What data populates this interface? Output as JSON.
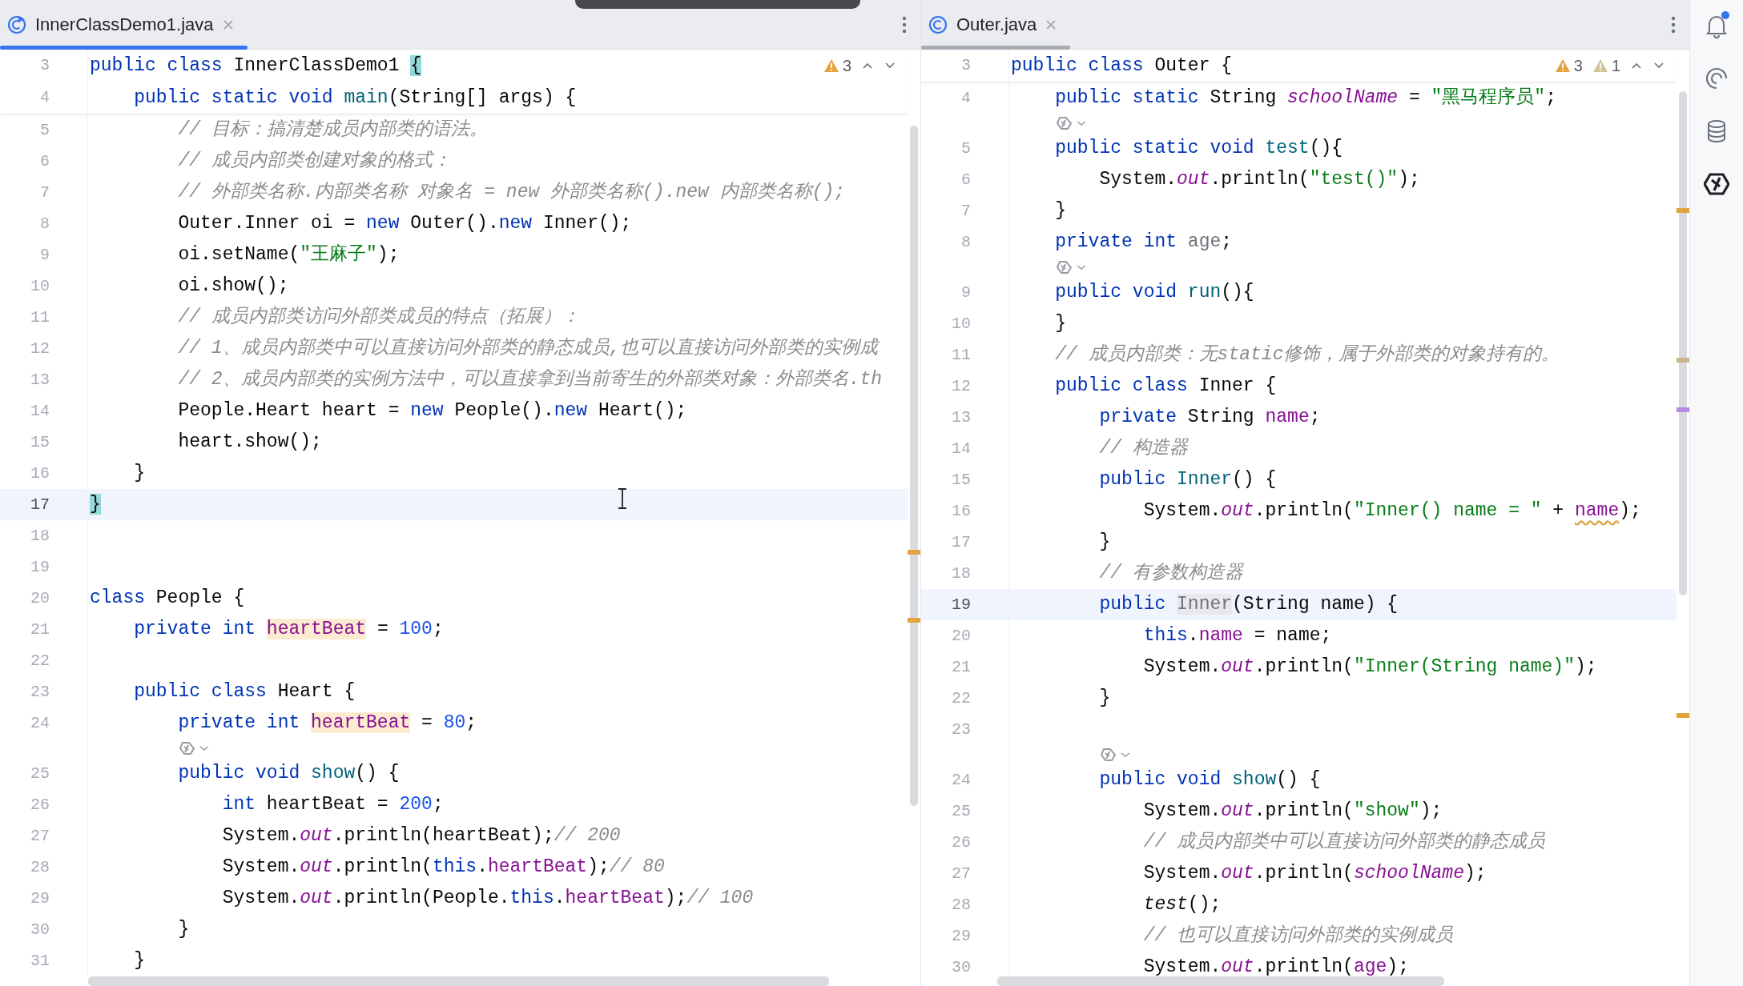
{
  "editors": [
    {
      "focused": true,
      "tabs": [
        {
          "label": "InnerClassDemo1.java",
          "selected": true,
          "kind": "runnable-class"
        }
      ],
      "inspection": {
        "warnings": "3"
      },
      "sticky_lines": [
        {
          "number": "3",
          "current": false,
          "tokens": [
            {
              "kind": "keyword",
              "text": "public class"
            },
            {
              "kind": "plain",
              "text": " InnerClassDemo1 "
            },
            {
              "kind": "plain",
              "text": "{",
              "highlighted": true
            }
          ]
        },
        {
          "number": "4",
          "current": false,
          "tokens": [
            {
              "kind": "keyword",
              "text": "    public static void "
            },
            {
              "kind": "method",
              "text": "main"
            },
            {
              "kind": "plain",
              "text": "(String[] args) {"
            }
          ]
        }
      ],
      "lines": [
        {
          "kind": "code",
          "number": "5",
          "current": false,
          "tokens": [
            {
              "kind": "comment",
              "text": "        // 目标：搞清楚成员内部类的语法。"
            }
          ]
        },
        {
          "kind": "code",
          "number": "6",
          "current": false,
          "tokens": [
            {
              "kind": "comment",
              "text": "        // 成员内部类创建对象的格式："
            }
          ]
        },
        {
          "kind": "code",
          "number": "7",
          "current": false,
          "tokens": [
            {
              "kind": "comment",
              "text": "        // 外部类名称.内部类名称 对象名 = new 外部类名称().new 内部类名称();"
            }
          ]
        },
        {
          "kind": "code",
          "number": "8",
          "current": false,
          "tokens": [
            {
              "kind": "plain",
              "text": "        Outer.Inner oi = "
            },
            {
              "kind": "keyword",
              "text": "new"
            },
            {
              "kind": "plain",
              "text": " Outer()."
            },
            {
              "kind": "keyword",
              "text": "new"
            },
            {
              "kind": "plain",
              "text": " Inner();"
            }
          ]
        },
        {
          "kind": "code",
          "number": "9",
          "current": false,
          "tokens": [
            {
              "kind": "plain",
              "text": "        oi.setName("
            },
            {
              "kind": "string",
              "text": "\"王麻子\""
            },
            {
              "kind": "plain",
              "text": ");"
            }
          ]
        },
        {
          "kind": "code",
          "number": "10",
          "current": false,
          "tokens": [
            {
              "kind": "plain",
              "text": "        oi.show();"
            }
          ]
        },
        {
          "kind": "code",
          "number": "11",
          "current": false,
          "tokens": [
            {
              "kind": "comment",
              "text": "        // 成员内部类访问外部类成员的特点（拓展）："
            }
          ]
        },
        {
          "kind": "code",
          "number": "12",
          "current": false,
          "tokens": [
            {
              "kind": "comment",
              "text": "        // 1、成员内部类中可以直接访问外部类的静态成员,也可以直接访问外部类的实例成"
            }
          ]
        },
        {
          "kind": "code",
          "number": "13",
          "current": false,
          "tokens": [
            {
              "kind": "comment",
              "text": "        // 2、成员内部类的实例方法中，可以直接拿到当前寄生的外部类对象：外部类名.th"
            }
          ]
        },
        {
          "kind": "code",
          "number": "14",
          "current": false,
          "tokens": [
            {
              "kind": "plain",
              "text": "        People.Heart heart = "
            },
            {
              "kind": "keyword",
              "text": "new"
            },
            {
              "kind": "plain",
              "text": " People()."
            },
            {
              "kind": "keyword",
              "text": "new"
            },
            {
              "kind": "plain",
              "text": " Heart();"
            }
          ]
        },
        {
          "kind": "code",
          "number": "15",
          "current": false,
          "tokens": [
            {
              "kind": "plain",
              "text": "        heart.show();"
            }
          ]
        },
        {
          "kind": "code",
          "number": "16",
          "current": false,
          "tokens": [
            {
              "kind": "plain",
              "text": "    }"
            }
          ]
        },
        {
          "kind": "code",
          "number": "17",
          "current": true,
          "tokens": [
            {
              "kind": "plain",
              "text": "}",
              "highlighted": true
            }
          ]
        },
        {
          "kind": "code",
          "number": "18",
          "current": false
        },
        {
          "kind": "code",
          "number": "19",
          "current": false
        },
        {
          "kind": "code",
          "number": "20",
          "current": false,
          "tokens": [
            {
              "kind": "keyword",
              "text": "class"
            },
            {
              "kind": "plain",
              "text": " People {"
            }
          ]
        },
        {
          "kind": "code",
          "number": "21",
          "current": false,
          "tokens": [
            {
              "kind": "keyword",
              "text": "    private int "
            },
            {
              "kind": "field",
              "text": "heartBeat",
              "highlighted": true
            },
            {
              "kind": "plain",
              "text": " = "
            },
            {
              "kind": "number",
              "text": "100"
            },
            {
              "kind": "plain",
              "text": ";"
            }
          ]
        },
        {
          "kind": "code",
          "number": "22",
          "current": false
        },
        {
          "kind": "code",
          "number": "23",
          "current": false,
          "tokens": [
            {
              "kind": "keyword",
              "text": "    public class"
            },
            {
              "kind": "plain",
              "text": " Heart {"
            }
          ]
        },
        {
          "kind": "code",
          "number": "24",
          "current": false,
          "tokens": [
            {
              "kind": "keyword",
              "text": "        private int "
            },
            {
              "kind": "field",
              "text": "heartBeat",
              "highlighted": true
            },
            {
              "kind": "plain",
              "text": " = "
            },
            {
              "kind": "number",
              "text": "80"
            },
            {
              "kind": "plain",
              "text": ";"
            }
          ]
        },
        {
          "kind": "hint"
        },
        {
          "kind": "code",
          "number": "25",
          "current": false,
          "tokens": [
            {
              "kind": "keyword",
              "text": "        public void "
            },
            {
              "kind": "method",
              "text": "show"
            },
            {
              "kind": "plain",
              "text": "() {"
            }
          ]
        },
        {
          "kind": "code",
          "number": "26",
          "current": false,
          "tokens": [
            {
              "kind": "keyword",
              "text": "            int"
            },
            {
              "kind": "plain",
              "text": " heartBeat = "
            },
            {
              "kind": "number",
              "text": "200"
            },
            {
              "kind": "plain",
              "text": ";"
            }
          ]
        },
        {
          "kind": "code",
          "number": "27",
          "current": false,
          "tokens": [
            {
              "kind": "plain",
              "text": "            System."
            },
            {
              "kind": "static_field",
              "text": "out"
            },
            {
              "kind": "plain",
              "text": ".println(heartBeat);"
            },
            {
              "kind": "comment",
              "text": "// 200"
            }
          ]
        },
        {
          "kind": "code",
          "number": "28",
          "current": false,
          "tokens": [
            {
              "kind": "plain",
              "text": "            System."
            },
            {
              "kind": "static_field",
              "text": "out"
            },
            {
              "kind": "plain",
              "text": ".println("
            },
            {
              "kind": "keyword",
              "text": "this"
            },
            {
              "kind": "plain",
              "text": "."
            },
            {
              "kind": "field",
              "text": "heartBeat"
            },
            {
              "kind": "plain",
              "text": ");"
            },
            {
              "kind": "comment",
              "text": "// 80"
            }
          ]
        },
        {
          "kind": "code",
          "number": "29",
          "current": false,
          "tokens": [
            {
              "kind": "plain",
              "text": "            System."
            },
            {
              "kind": "static_field",
              "text": "out"
            },
            {
              "kind": "plain",
              "text": ".println(People."
            },
            {
              "kind": "keyword",
              "text": "this"
            },
            {
              "kind": "plain",
              "text": "."
            },
            {
              "kind": "field",
              "text": "heartBeat"
            },
            {
              "kind": "plain",
              "text": ");"
            },
            {
              "kind": "comment",
              "text": "// 100"
            }
          ]
        },
        {
          "kind": "code",
          "number": "30",
          "current": false,
          "tokens": [
            {
              "kind": "plain",
              "text": "        }"
            }
          ]
        },
        {
          "kind": "code",
          "number": "31",
          "current": false,
          "tokens": [
            {
              "kind": "plain",
              "text": "    }"
            }
          ]
        }
      ]
    },
    {
      "focused": false,
      "tabs": [
        {
          "label": "Outer.java",
          "selected": true,
          "kind": "class"
        }
      ],
      "inspection": {
        "warnings": "3",
        "weak_warnings": "1"
      },
      "sticky_lines": [
        {
          "number": "3",
          "current": false,
          "tokens": [
            {
              "kind": "keyword",
              "text": "public class"
            },
            {
              "kind": "plain",
              "text": " Outer {"
            }
          ]
        }
      ],
      "lines": [
        {
          "kind": "code",
          "number": "4",
          "current": false,
          "tokens": [
            {
              "kind": "keyword",
              "text": "    public static"
            },
            {
              "kind": "plain",
              "text": " String "
            },
            {
              "kind": "static_field",
              "text": "schoolName"
            },
            {
              "kind": "plain",
              "text": " = "
            },
            {
              "kind": "string",
              "text": "\"黑马程序员\""
            },
            {
              "kind": "plain",
              "text": ";"
            }
          ]
        },
        {
          "kind": "hint"
        },
        {
          "kind": "code",
          "number": "5",
          "current": false,
          "tokens": [
            {
              "kind": "keyword",
              "text": "    public static void "
            },
            {
              "kind": "method",
              "text": "test"
            },
            {
              "kind": "plain",
              "text": "(){"
            }
          ]
        },
        {
          "kind": "code",
          "number": "6",
          "current": false,
          "tokens": [
            {
              "kind": "plain",
              "text": "        System."
            },
            {
              "kind": "static_field",
              "text": "out"
            },
            {
              "kind": "plain",
              "text": ".println("
            },
            {
              "kind": "string",
              "text": "\"test()\""
            },
            {
              "kind": "plain",
              "text": ");"
            }
          ]
        },
        {
          "kind": "code",
          "number": "7",
          "current": false,
          "tokens": [
            {
              "kind": "plain",
              "text": "    }"
            }
          ]
        },
        {
          "kind": "code",
          "number": "8",
          "current": false,
          "tokens": [
            {
              "kind": "keyword",
              "text": "    private int "
            },
            {
              "kind": "unused",
              "text": "age"
            },
            {
              "kind": "plain",
              "text": ";"
            }
          ]
        },
        {
          "kind": "hint"
        },
        {
          "kind": "code",
          "number": "9",
          "current": false,
          "tokens": [
            {
              "kind": "keyword",
              "text": "    public void "
            },
            {
              "kind": "method",
              "text": "run"
            },
            {
              "kind": "plain",
              "text": "(){"
            }
          ]
        },
        {
          "kind": "code",
          "number": "10",
          "current": false,
          "tokens": [
            {
              "kind": "plain",
              "text": "    }"
            }
          ]
        },
        {
          "kind": "code",
          "number": "11",
          "current": false,
          "tokens": [
            {
              "kind": "comment",
              "text": "    // 成员内部类：无static修饰，属于外部类的对象持有的。"
            }
          ]
        },
        {
          "kind": "code",
          "number": "12",
          "current": false,
          "tokens": [
            {
              "kind": "keyword",
              "text": "    public class"
            },
            {
              "kind": "plain",
              "text": " Inner {"
            }
          ]
        },
        {
          "kind": "code",
          "number": "13",
          "current": false,
          "tokens": [
            {
              "kind": "keyword",
              "text": "        private"
            },
            {
              "kind": "plain",
              "text": " String "
            },
            {
              "kind": "field",
              "text": "name"
            },
            {
              "kind": "plain",
              "text": ";"
            }
          ]
        },
        {
          "kind": "code",
          "number": "14",
          "current": false,
          "tokens": [
            {
              "kind": "comment",
              "text": "        // 构造器"
            }
          ]
        },
        {
          "kind": "code",
          "number": "15",
          "current": false,
          "tokens": [
            {
              "kind": "keyword",
              "text": "        public "
            },
            {
              "kind": "method",
              "text": "Inner"
            },
            {
              "kind": "plain",
              "text": "() {"
            }
          ]
        },
        {
          "kind": "code",
          "number": "16",
          "current": false,
          "tokens": [
            {
              "kind": "plain",
              "text": "            System."
            },
            {
              "kind": "static_field",
              "text": "out"
            },
            {
              "kind": "plain",
              "text": ".println("
            },
            {
              "kind": "string",
              "text": "\"Inner() name = \""
            },
            {
              "kind": "plain",
              "text": " + "
            },
            {
              "kind": "field",
              "text": "name",
              "warning": true
            },
            {
              "kind": "plain",
              "text": ");"
            }
          ]
        },
        {
          "kind": "code",
          "number": "17",
          "current": false,
          "tokens": [
            {
              "kind": "plain",
              "text": "        }"
            }
          ]
        },
        {
          "kind": "code",
          "number": "18",
          "current": false,
          "tokens": [
            {
              "kind": "comment",
              "text": "        // 有参数构造器"
            }
          ]
        },
        {
          "kind": "code",
          "number": "19",
          "current": true,
          "tokens": [
            {
              "kind": "keyword",
              "text": "        public "
            },
            {
              "kind": "unused",
              "text": "Inner",
              "highlighted": true
            },
            {
              "kind": "plain",
              "text": "(String name) {"
            }
          ]
        },
        {
          "kind": "code",
          "number": "20",
          "current": false,
          "tokens": [
            {
              "kind": "keyword",
              "text": "            this"
            },
            {
              "kind": "plain",
              "text": "."
            },
            {
              "kind": "field",
              "text": "name"
            },
            {
              "kind": "plain",
              "text": " = name;"
            }
          ]
        },
        {
          "kind": "code",
          "number": "21",
          "current": false,
          "tokens": [
            {
              "kind": "plain",
              "text": "            System."
            },
            {
              "kind": "static_field",
              "text": "out"
            },
            {
              "kind": "plain",
              "text": ".println("
            },
            {
              "kind": "string",
              "text": "\"Inner(String name)\""
            },
            {
              "kind": "plain",
              "text": ");"
            }
          ]
        },
        {
          "kind": "code",
          "number": "22",
          "current": false,
          "tokens": [
            {
              "kind": "plain",
              "text": "        }"
            }
          ]
        },
        {
          "kind": "code",
          "number": "23",
          "current": false
        },
        {
          "kind": "hint"
        },
        {
          "kind": "code",
          "number": "24",
          "current": false,
          "tokens": [
            {
              "kind": "keyword",
              "text": "        public void "
            },
            {
              "kind": "method",
              "text": "show"
            },
            {
              "kind": "plain",
              "text": "() {"
            }
          ]
        },
        {
          "kind": "code",
          "number": "25",
          "current": false,
          "tokens": [
            {
              "kind": "plain",
              "text": "            System."
            },
            {
              "kind": "static_field",
              "text": "out"
            },
            {
              "kind": "plain",
              "text": ".println("
            },
            {
              "kind": "string",
              "text": "\"show\""
            },
            {
              "kind": "plain",
              "text": ");"
            }
          ]
        },
        {
          "kind": "code",
          "number": "26",
          "current": false,
          "tokens": [
            {
              "kind": "comment",
              "text": "            // 成员内部类中可以直接访问外部类的静态成员"
            }
          ]
        },
        {
          "kind": "code",
          "number": "27",
          "current": false,
          "tokens": [
            {
              "kind": "plain",
              "text": "            System."
            },
            {
              "kind": "static_field",
              "text": "out"
            },
            {
              "kind": "plain",
              "text": ".println("
            },
            {
              "kind": "static_field",
              "text": "schoolName"
            },
            {
              "kind": "plain",
              "text": ");"
            }
          ]
        },
        {
          "kind": "code",
          "number": "28",
          "current": false,
          "tokens": [
            {
              "kind": "static_call",
              "text": "            test"
            },
            {
              "kind": "plain",
              "text": "();"
            }
          ]
        },
        {
          "kind": "code",
          "number": "29",
          "current": false,
          "tokens": [
            {
              "kind": "comment",
              "text": "            // 也可以直接访问外部类的实例成员"
            }
          ]
        },
        {
          "kind": "code",
          "number": "30",
          "current": false,
          "tokens": [
            {
              "kind": "plain",
              "text": "            System."
            },
            {
              "kind": "static_field",
              "text": "out"
            },
            {
              "kind": "plain",
              "text": ".println("
            },
            {
              "kind": "field",
              "text": "age"
            },
            {
              "kind": "plain",
              "text": ");"
            }
          ]
        }
      ]
    }
  ],
  "tool_window_bar": {
    "has_notifications": true
  }
}
